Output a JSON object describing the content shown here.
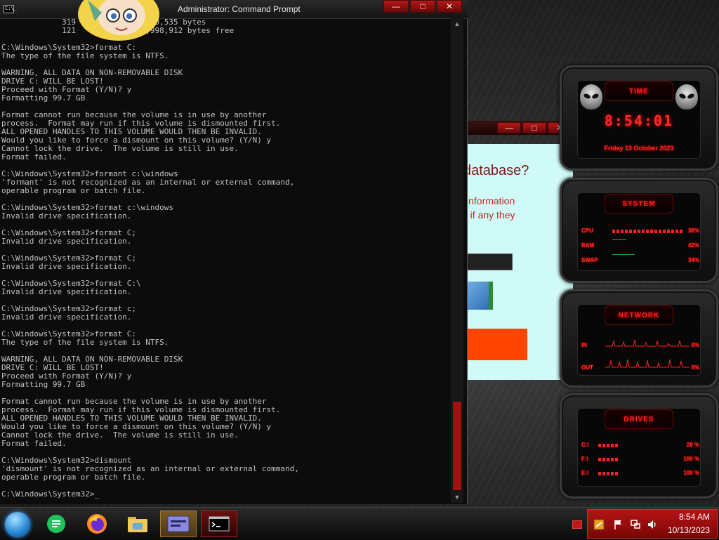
{
  "cmd": {
    "title": "Administrator: Command Prompt",
    "icon_label": "C:\\_",
    "minimize": "—",
    "maximize": "□",
    "close": "✕",
    "scroll_up": "▲",
    "scroll_down": "▼",
    "lines": [
      "             319           636,200,535 bytes",
      "             121           ,728,998,912 bytes free",
      "",
      "C:\\Windows\\System32>format C:",
      "The type of the file system is NTFS.",
      "",
      "WARNING, ALL DATA ON NON-REMOVABLE DISK",
      "DRIVE C: WILL BE LOST!",
      "Proceed with Format (Y/N)? y",
      "Formatting 99.7 GB",
      "",
      "Format cannot run because the volume is in use by another",
      "process.  Format may run if this volume is dismounted first.",
      "ALL OPENED HANDLES TO THIS VOLUME WOULD THEN BE INVALID.",
      "Would you like to force a dismount on this volume? (Y/N) y",
      "Cannot lock the drive.  The volume is still in use.",
      "Format failed.",
      "",
      "C:\\Windows\\System32>formant c:\\windows",
      "'formant' is not recognized as an internal or external command,",
      "operable program or batch file.",
      "",
      "C:\\Windows\\System32>format c:\\windows",
      "Invalid drive specification.",
      "",
      "C:\\Windows\\System32>format C;",
      "Invalid drive specification.",
      "",
      "C:\\Windows\\System32>format C;",
      "Invalid drive specification.",
      "",
      "C:\\Windows\\System32>format C:\\",
      "Invalid drive specification.",
      "",
      "C:\\Windows\\System32>format c;",
      "Invalid drive specification.",
      "",
      "C:\\Windows\\System32>format C:",
      "The type of the file system is NTFS.",
      "",
      "WARNING, ALL DATA ON NON-REMOVABLE DISK",
      "DRIVE C: WILL BE LOST!",
      "Proceed with Format (Y/N)? y",
      "Formatting 99.7 GB",
      "",
      "Format cannot run because the volume is in use by another",
      "process.  Format may run if this volume is dismounted first.",
      "ALL OPENED HANDLES TO THIS VOLUME WOULD THEN BE INVALID.",
      "Would you like to force a dismount on this volume? (Y/N) y",
      "Cannot lock the drive.  The volume is still in use.",
      "Format failed.",
      "",
      "C:\\Windows\\System32>dismount",
      "'dismount' is not recognized as an internal or external command,",
      "operable program or batch file.",
      "",
      "C:\\Windows\\System32>_"
    ]
  },
  "dialog": {
    "heading": "database?",
    "text1": "information",
    "text2": "e if any they",
    "minimize": "—",
    "maximize": "□",
    "close": "✕"
  },
  "gadgets": {
    "time": {
      "header": "TIME",
      "clock": "8:54:01",
      "date": "Friday 13 October 2023"
    },
    "system": {
      "header": "SYSTEM",
      "rows": [
        {
          "label": "CPU",
          "value": "38%"
        },
        {
          "label": "RAM",
          "value": "42%"
        },
        {
          "label": "SWAP",
          "value": "34%"
        }
      ]
    },
    "network": {
      "header": "NETWORK",
      "rows": [
        {
          "label": "IN",
          "value": "0%"
        },
        {
          "label": "OUT",
          "value": "0%"
        }
      ]
    },
    "drives": {
      "header": "DRIVES",
      "rows": [
        {
          "label": "C:\\",
          "value": "28 %"
        },
        {
          "label": "F:\\",
          "value": "100 %"
        },
        {
          "label": "E:\\",
          "value": "100 %"
        }
      ]
    }
  },
  "taskbar": {
    "time": "8:54 AM",
    "date": "10/13/2023",
    "apps": [
      "start-orb",
      "chat",
      "firefox",
      "file-explorer",
      "window-manager",
      "command-prompt"
    ]
  },
  "colors": {
    "accent_red": "#ff2a2a",
    "cmd_bg": "#0c0c0c",
    "cmd_fg": "#c0c0c0",
    "tray_red": "#b51414"
  }
}
